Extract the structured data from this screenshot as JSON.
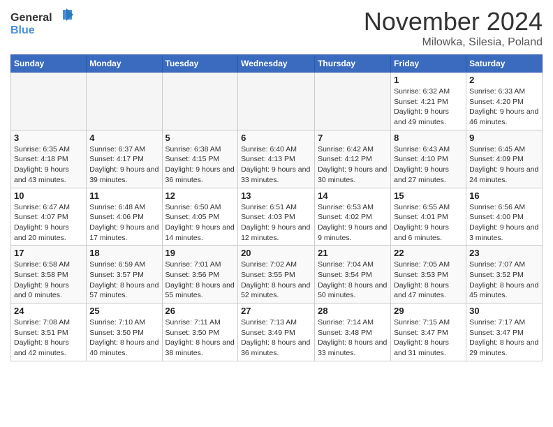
{
  "header": {
    "logo_general": "General",
    "logo_blue": "Blue",
    "month_title": "November 2024",
    "subtitle": "Milowka, Silesia, Poland"
  },
  "weekdays": [
    "Sunday",
    "Monday",
    "Tuesday",
    "Wednesday",
    "Thursday",
    "Friday",
    "Saturday"
  ],
  "weeks": [
    [
      {
        "day": "",
        "info": ""
      },
      {
        "day": "",
        "info": ""
      },
      {
        "day": "",
        "info": ""
      },
      {
        "day": "",
        "info": ""
      },
      {
        "day": "",
        "info": ""
      },
      {
        "day": "1",
        "info": "Sunrise: 6:32 AM\nSunset: 4:21 PM\nDaylight: 9 hours and 49 minutes."
      },
      {
        "day": "2",
        "info": "Sunrise: 6:33 AM\nSunset: 4:20 PM\nDaylight: 9 hours and 46 minutes."
      }
    ],
    [
      {
        "day": "3",
        "info": "Sunrise: 6:35 AM\nSunset: 4:18 PM\nDaylight: 9 hours and 43 minutes."
      },
      {
        "day": "4",
        "info": "Sunrise: 6:37 AM\nSunset: 4:17 PM\nDaylight: 9 hours and 39 minutes."
      },
      {
        "day": "5",
        "info": "Sunrise: 6:38 AM\nSunset: 4:15 PM\nDaylight: 9 hours and 36 minutes."
      },
      {
        "day": "6",
        "info": "Sunrise: 6:40 AM\nSunset: 4:13 PM\nDaylight: 9 hours and 33 minutes."
      },
      {
        "day": "7",
        "info": "Sunrise: 6:42 AM\nSunset: 4:12 PM\nDaylight: 9 hours and 30 minutes."
      },
      {
        "day": "8",
        "info": "Sunrise: 6:43 AM\nSunset: 4:10 PM\nDaylight: 9 hours and 27 minutes."
      },
      {
        "day": "9",
        "info": "Sunrise: 6:45 AM\nSunset: 4:09 PM\nDaylight: 9 hours and 24 minutes."
      }
    ],
    [
      {
        "day": "10",
        "info": "Sunrise: 6:47 AM\nSunset: 4:07 PM\nDaylight: 9 hours and 20 minutes."
      },
      {
        "day": "11",
        "info": "Sunrise: 6:48 AM\nSunset: 4:06 PM\nDaylight: 9 hours and 17 minutes."
      },
      {
        "day": "12",
        "info": "Sunrise: 6:50 AM\nSunset: 4:05 PM\nDaylight: 9 hours and 14 minutes."
      },
      {
        "day": "13",
        "info": "Sunrise: 6:51 AM\nSunset: 4:03 PM\nDaylight: 9 hours and 12 minutes."
      },
      {
        "day": "14",
        "info": "Sunrise: 6:53 AM\nSunset: 4:02 PM\nDaylight: 9 hours and 9 minutes."
      },
      {
        "day": "15",
        "info": "Sunrise: 6:55 AM\nSunset: 4:01 PM\nDaylight: 9 hours and 6 minutes."
      },
      {
        "day": "16",
        "info": "Sunrise: 6:56 AM\nSunset: 4:00 PM\nDaylight: 9 hours and 3 minutes."
      }
    ],
    [
      {
        "day": "17",
        "info": "Sunrise: 6:58 AM\nSunset: 3:58 PM\nDaylight: 9 hours and 0 minutes."
      },
      {
        "day": "18",
        "info": "Sunrise: 6:59 AM\nSunset: 3:57 PM\nDaylight: 8 hours and 57 minutes."
      },
      {
        "day": "19",
        "info": "Sunrise: 7:01 AM\nSunset: 3:56 PM\nDaylight: 8 hours and 55 minutes."
      },
      {
        "day": "20",
        "info": "Sunrise: 7:02 AM\nSunset: 3:55 PM\nDaylight: 8 hours and 52 minutes."
      },
      {
        "day": "21",
        "info": "Sunrise: 7:04 AM\nSunset: 3:54 PM\nDaylight: 8 hours and 50 minutes."
      },
      {
        "day": "22",
        "info": "Sunrise: 7:05 AM\nSunset: 3:53 PM\nDaylight: 8 hours and 47 minutes."
      },
      {
        "day": "23",
        "info": "Sunrise: 7:07 AM\nSunset: 3:52 PM\nDaylight: 8 hours and 45 minutes."
      }
    ],
    [
      {
        "day": "24",
        "info": "Sunrise: 7:08 AM\nSunset: 3:51 PM\nDaylight: 8 hours and 42 minutes."
      },
      {
        "day": "25",
        "info": "Sunrise: 7:10 AM\nSunset: 3:50 PM\nDaylight: 8 hours and 40 minutes."
      },
      {
        "day": "26",
        "info": "Sunrise: 7:11 AM\nSunset: 3:50 PM\nDaylight: 8 hours and 38 minutes."
      },
      {
        "day": "27",
        "info": "Sunrise: 7:13 AM\nSunset: 3:49 PM\nDaylight: 8 hours and 36 minutes."
      },
      {
        "day": "28",
        "info": "Sunrise: 7:14 AM\nSunset: 3:48 PM\nDaylight: 8 hours and 33 minutes."
      },
      {
        "day": "29",
        "info": "Sunrise: 7:15 AM\nSunset: 3:47 PM\nDaylight: 8 hours and 31 minutes."
      },
      {
        "day": "30",
        "info": "Sunrise: 7:17 AM\nSunset: 3:47 PM\nDaylight: 8 hours and 29 minutes."
      }
    ]
  ]
}
